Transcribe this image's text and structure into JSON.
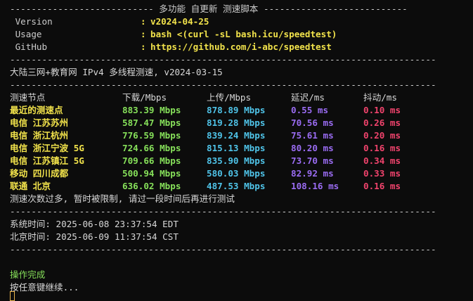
{
  "header": {
    "top_rule": "--------------------------- 多功能 自更新 测速脚本 ---------------------------",
    "rows": [
      {
        "key": " Version",
        "val": "v2024-04-25"
      },
      {
        "key": " Usage",
        "val": "bash <(curl -sL bash.icu/speedtest)"
      },
      {
        "key": " GitHub",
        "val": "https://github.com/i-abc/speedtest"
      }
    ],
    "colon": ":",
    "rule": "--------------------------------------------------------------------------------"
  },
  "mode_title": "大陆三网+教育网 IPv4 多线程测速, v2024-03-15",
  "table": {
    "headers": {
      "node": "测速节点",
      "down": "下载/Mbps",
      "up": "上传/Mbps",
      "lat": "延迟/ms",
      "jit": "抖动/ms"
    },
    "rows": [
      {
        "node": "最近的测速点",
        "down": "883.39 Mbps",
        "up": "878.89 Mbps",
        "lat": "0.55 ms",
        "jit": "0.10 ms"
      },
      {
        "node": "电信 江苏苏州",
        "down": "587.47 Mbps",
        "up": "819.28 Mbps",
        "lat": "70.56 ms",
        "jit": "0.26 ms"
      },
      {
        "node": "电信 浙江杭州",
        "down": "776.59 Mbps",
        "up": "839.24 Mbps",
        "lat": "75.61 ms",
        "jit": "0.20 ms"
      },
      {
        "node": "电信 浙江宁波 5G",
        "down": "724.66 Mbps",
        "up": "815.13 Mbps",
        "lat": "80.20 ms",
        "jit": "0.16 ms"
      },
      {
        "node": "电信 江苏镇江 5G",
        "down": "709.66 Mbps",
        "up": "835.90 Mbps",
        "lat": "73.70 ms",
        "jit": "0.34 ms"
      },
      {
        "node": "移动 四川成都",
        "down": "500.94 Mbps",
        "up": "580.03 Mbps",
        "lat": "82.92 ms",
        "jit": "0.33 ms"
      },
      {
        "node": "联通 北京",
        "down": "636.02 Mbps",
        "up": "487.53 Mbps",
        "lat": "108.16 ms",
        "jit": "0.16 ms"
      }
    ],
    "limit_notice": "测速次数过多, 暂时被限制, 请过一段时间后再进行测试"
  },
  "times": {
    "system": "系统时间: 2025-06-08 23:37:54 EDT",
    "beijing": "北京时间: 2025-06-09 11:37:54 CST"
  },
  "footer": {
    "done": "操作完成",
    "prompt": "按任意键继续..."
  },
  "colors": {
    "background": "#0c0c0c",
    "node": "#f2e34b",
    "download": "#86e05a",
    "upload": "#4fc3e8",
    "latency": "#9a6cf2",
    "jitter": "#f0436c",
    "cursor": "#e8b44c"
  }
}
